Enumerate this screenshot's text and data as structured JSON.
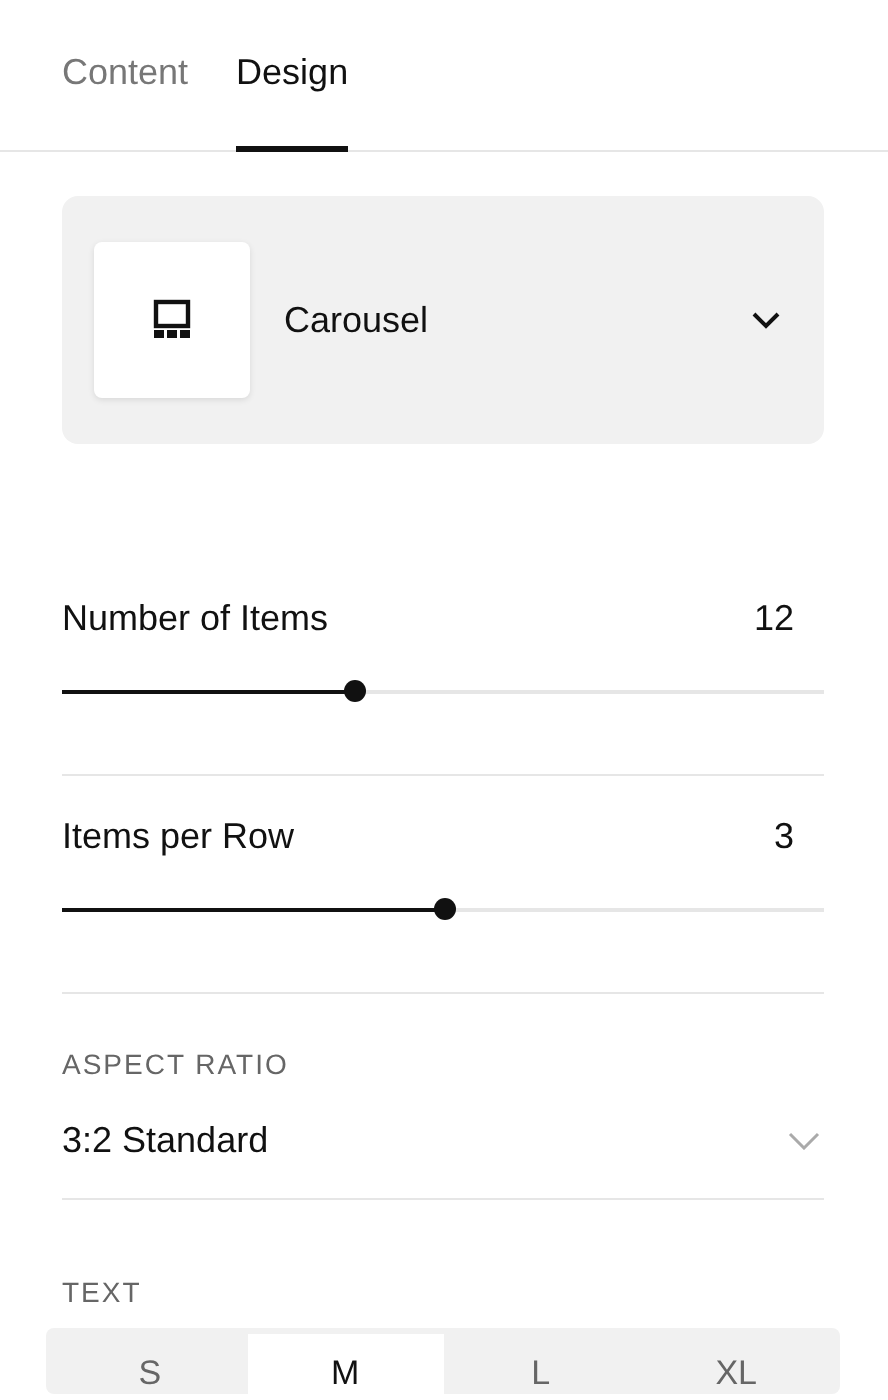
{
  "tabs": [
    {
      "label": "Content",
      "selected": false
    },
    {
      "label": "Design",
      "selected": true
    }
  ],
  "layout_picker": {
    "value": "Carousel"
  },
  "sliders": [
    {
      "label": "Number of Items",
      "reading": "12",
      "level": 0.384
    },
    {
      "label": "Items per Row",
      "reading": "3",
      "level": 0.5
    }
  ],
  "aspect_ratio": {
    "label": "ASPECT RATIO",
    "value": "3:2 Standard"
  },
  "text_size": {
    "label": "TEXT",
    "options": [
      {
        "label": "S",
        "selected": false
      },
      {
        "label": "M",
        "selected": true
      },
      {
        "label": "L",
        "selected": false
      },
      {
        "label": "XL",
        "selected": false
      }
    ]
  }
}
